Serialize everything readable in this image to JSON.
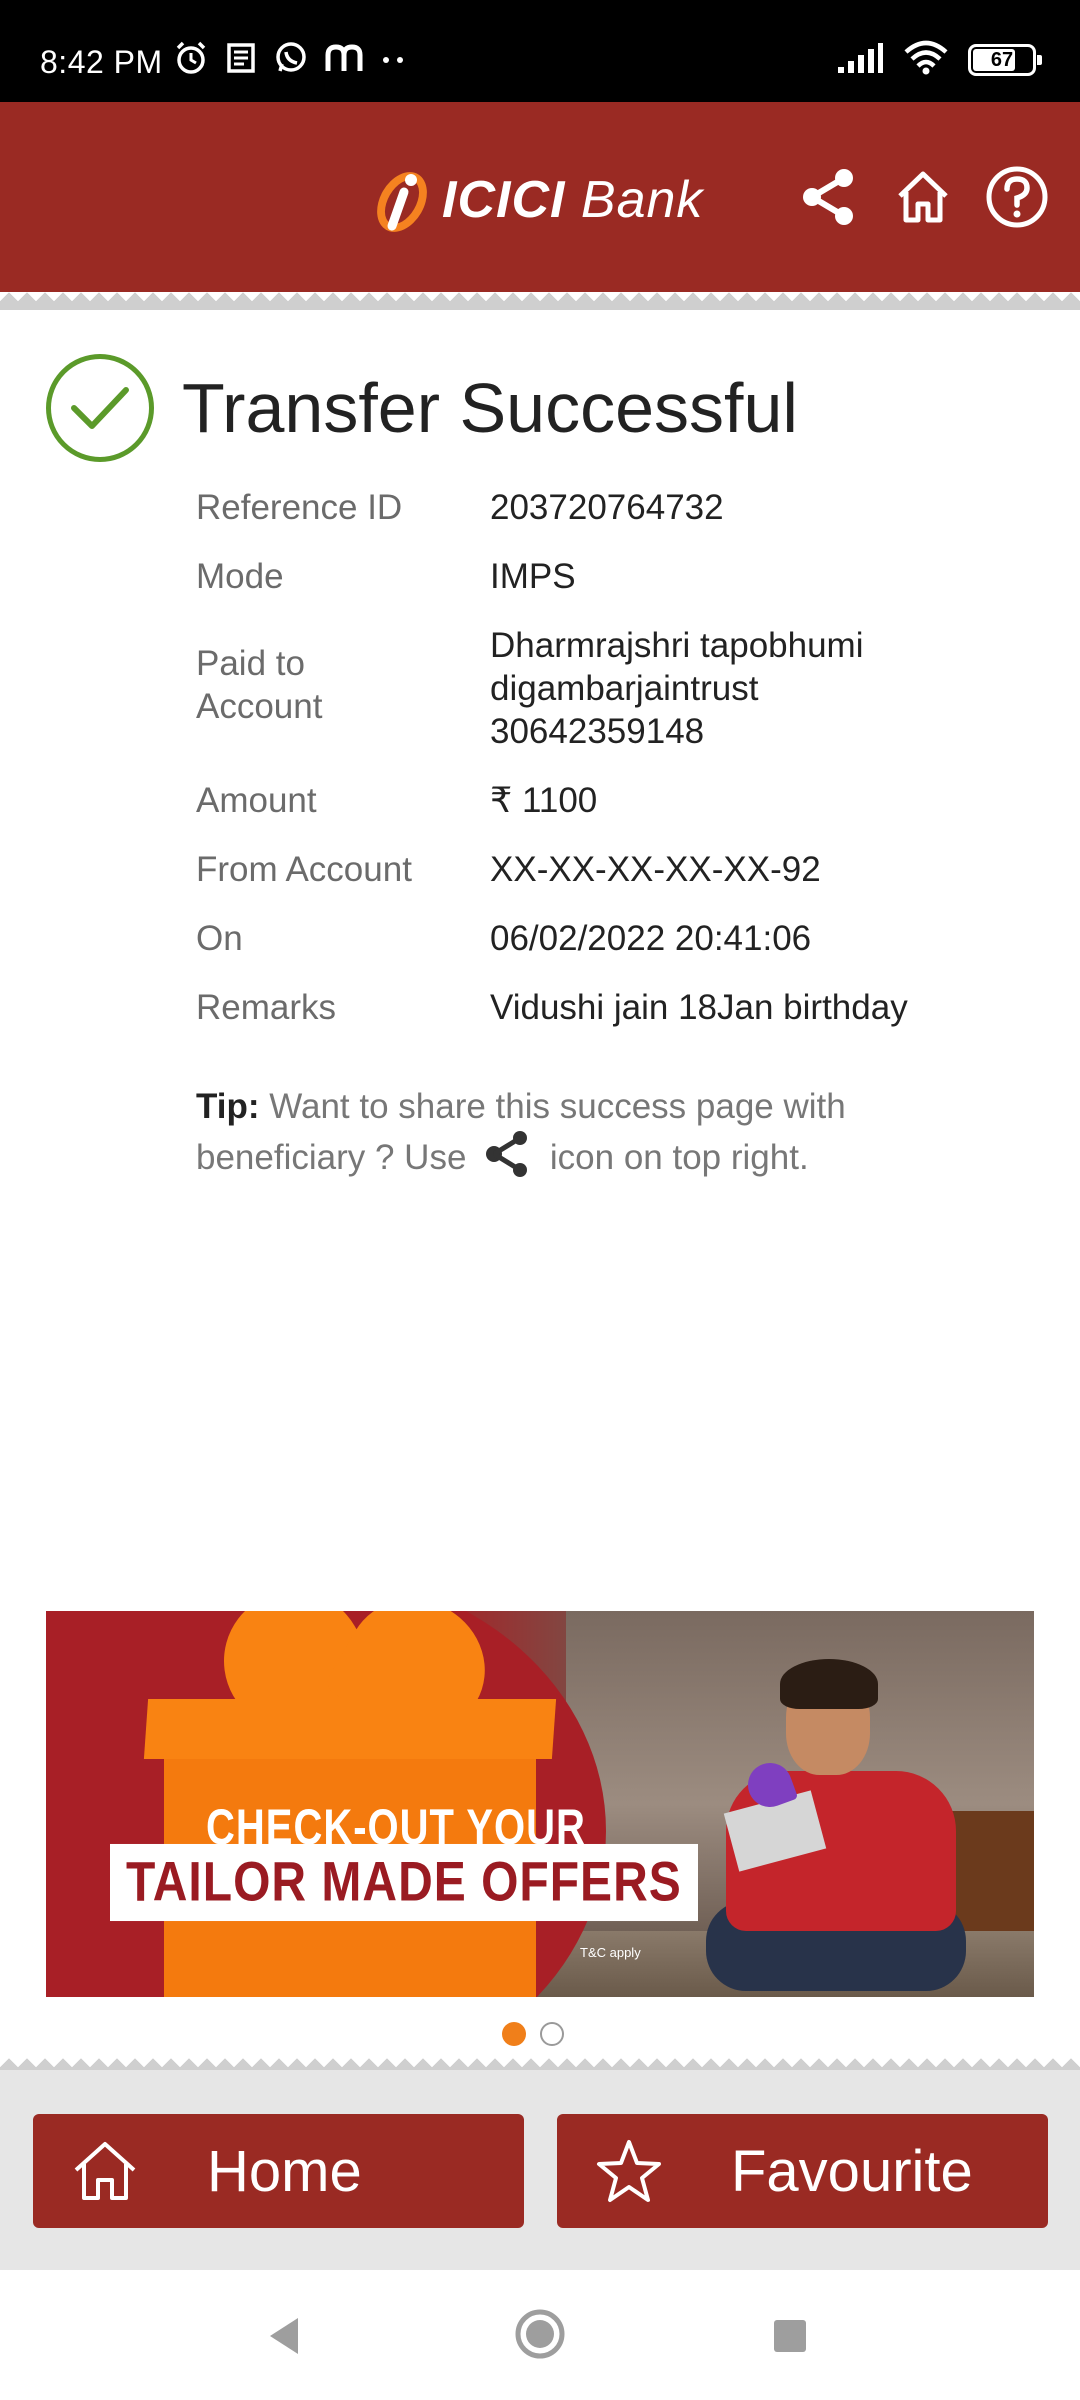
{
  "status_bar": {
    "time": "8:42 PM",
    "battery": "67",
    "left_icons": [
      "alarm-icon",
      "news-icon",
      "whatsapp-icon",
      "m-icon",
      "more-dots-icon"
    ],
    "right_icons": [
      "signal-icon",
      "wifi-icon",
      "battery-icon"
    ]
  },
  "header": {
    "logo_bold": "ICICI",
    "logo_light": "Bank",
    "actions": [
      "share-icon",
      "home-icon",
      "help-icon"
    ]
  },
  "result": {
    "title": "Transfer Successful",
    "status_color": "#5b9a2a"
  },
  "details": [
    {
      "label": "Reference ID",
      "value": "203720764732"
    },
    {
      "label": "Mode",
      "value": "IMPS"
    },
    {
      "label": "Paid to Account",
      "value_lines": [
        "Dharmrajshri tapobhumi",
        "digambarjaintrust",
        "30642359148"
      ]
    },
    {
      "label": "Amount",
      "value": "₹ 1100"
    },
    {
      "label": "From Account",
      "value": "XX-XX-XX-XX-XX-92"
    },
    {
      "label": "On",
      "value": "06/02/2022 20:41:06"
    },
    {
      "label": "Remarks",
      "value": "Vidushi jain 18Jan birthday"
    }
  ],
  "tip": {
    "prefix": "Tip:",
    "text_before_icon": "Want to share this success page with beneficiary ? Use",
    "text_after_icon": "icon on top right."
  },
  "banner": {
    "line1": "CHECK-OUT YOUR",
    "line2": "TAILOR MADE OFFERS",
    "tnc": "T&C apply",
    "active_slide": 1,
    "slide_count": 2
  },
  "bottom_actions": {
    "home_label": "Home",
    "favourite_label": "Favourite"
  },
  "colors": {
    "brand_red": "#9a2a23",
    "accent_orange": "#f07f1a"
  }
}
